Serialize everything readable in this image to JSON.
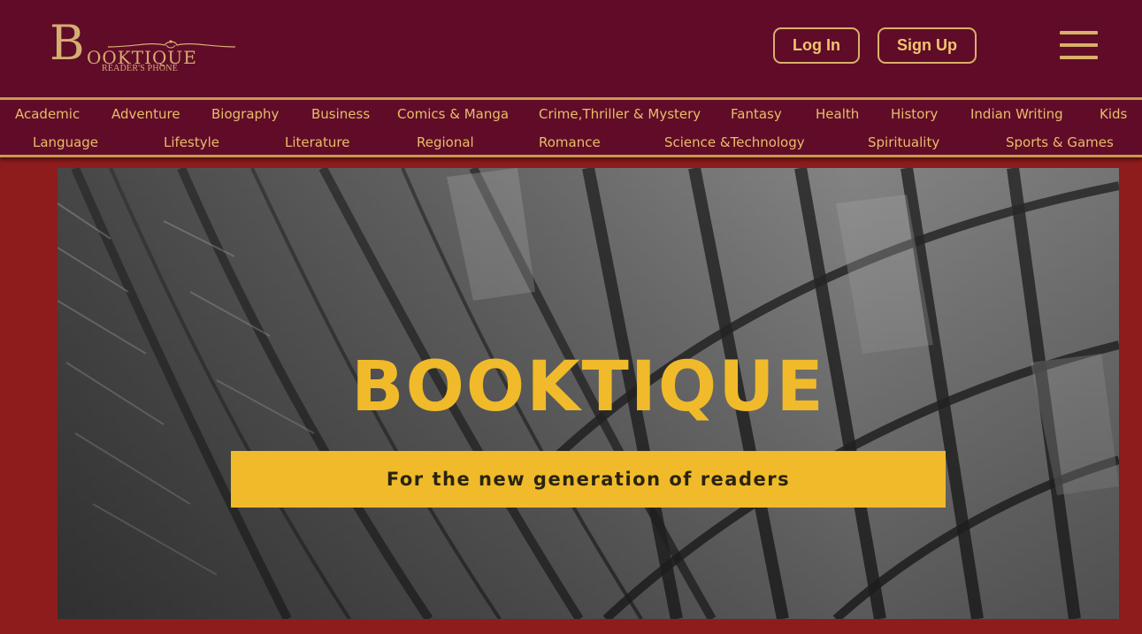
{
  "header": {
    "logo": {
      "initial": "B",
      "word": "OOKTIQUE",
      "tagline": "READER'S PHONE"
    },
    "login_label": "Log In",
    "signup_label": "Sign Up",
    "menu_icon": "hamburger-menu-icon"
  },
  "categories": {
    "row1": [
      "Academic",
      "Adventure",
      "Biography",
      "Business",
      "Comics & Manga",
      "Crime,Thriller & Mystery",
      "Fantasy",
      "Health",
      "History",
      "Indian Writing",
      "Kids"
    ],
    "row2": [
      "Language",
      "Lifestyle",
      "Literature",
      "Regional",
      "Romance",
      "Science &Technology",
      "Spirituality",
      "Sports & Games"
    ]
  },
  "hero": {
    "title": "BOOKTIQUE",
    "tagline": "For the new generation of readers"
  },
  "colors": {
    "header_bg": "#600c28",
    "page_bg": "#8e1c1c",
    "gold": "#d9b06a",
    "hero_yellow": "#f0ba2a"
  }
}
